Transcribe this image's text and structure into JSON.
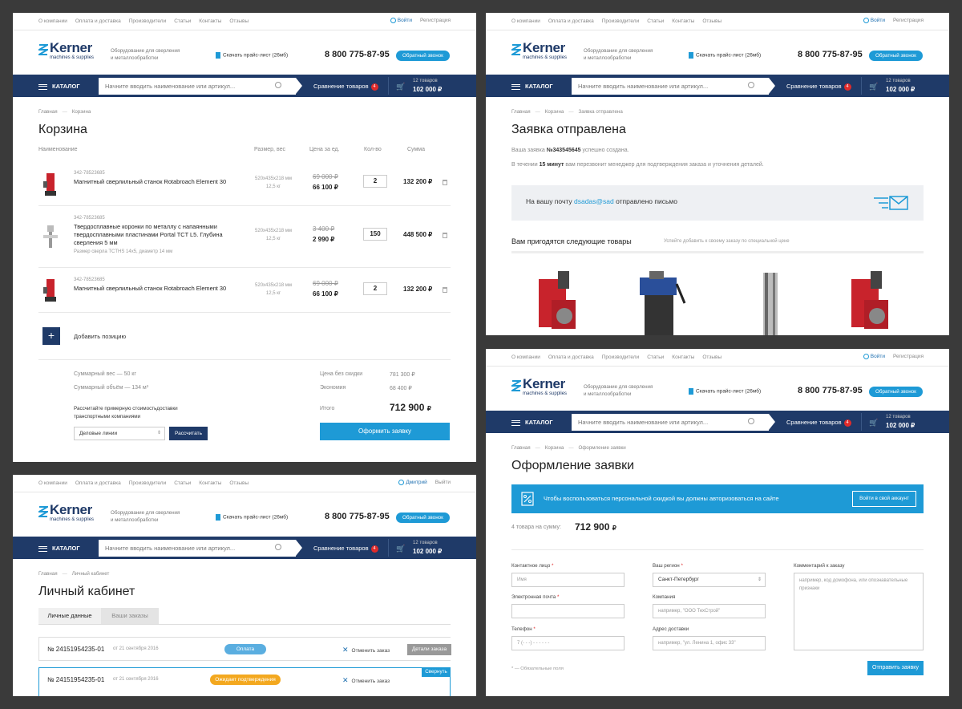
{
  "common": {
    "top_links": [
      "О компании",
      "Оплата и доставка",
      "Производители",
      "Статьи",
      "Контакты",
      "Отзывы"
    ],
    "login": "Войти",
    "register": "Регистрация",
    "brand": "Kerner",
    "brand_sub": "machines & supplies",
    "tagline": "Оборудование для сверления и металлообработки",
    "price_list": "Скачать прайс-лист (26мб)",
    "phone": "8 800 775-87-95",
    "callback": "Обратный звонок",
    "catalog": "КАТАЛОГ",
    "search_placeholder": "Начните вводить наименование или артикул...",
    "compare": "Сравнение товаров",
    "compare_count": "4",
    "cart_count": "12 товаров",
    "cart_sum": "102 000 ₽",
    "crumb_home": "Главная",
    "crumb_sep": "—"
  },
  "cart": {
    "crumb_current": "Корзина",
    "title": "Корзина",
    "col_name": "Наименование",
    "col_size": "Размер, вес",
    "col_price": "Цена за ед.",
    "col_qty": "Кол-во",
    "col_sum": "Сумма",
    "items": [
      {
        "sku": "342-78523685",
        "name": "Магнитный сверлильный станок Rotabroach Element 30",
        "note": "",
        "dims": "520x435x218 мм",
        "weight": "12,5 кг",
        "old": "69 000 ₽",
        "price": "66 100 ₽",
        "qty": "2",
        "total": "132 200 ₽"
      },
      {
        "sku": "342-78523685",
        "name": "Твердосплавные коронки по металлу с напаянными твердосплавными пластинами Portal TCT L5. Глубина сверления 5 мм",
        "note": "Размер сверла TCTHS 14x5, диаметр 14 мм",
        "dims": "520x435x218 мм",
        "weight": "12,5 кг",
        "old": "3 400 ₽",
        "price": "2 990 ₽",
        "qty": "150",
        "total": "448 500 ₽"
      },
      {
        "sku": "342-78523685",
        "name": "Магнитный сверлильный станок Rotabroach Element 30",
        "note": "",
        "dims": "520x435x218 мм",
        "weight": "12,5 кг",
        "old": "69 000 ₽",
        "price": "66 100 ₽",
        "qty": "2",
        "total": "132 200 ₽"
      }
    ],
    "add_position": "Добавить позицию",
    "weight": "Суммарный вес — 50 кг",
    "volume": "Суммарный объём — 134 м³",
    "calc_text": "Рассчитайте примерную стоимостьдоставки транспортными компаниями",
    "carrier": "Деловые линии",
    "calc_btn": "Рассчитать",
    "no_discount_label": "Цена без скидки",
    "no_discount": "781 300 ₽",
    "saving_label": "Экономия",
    "saving": "68 400 ₽",
    "total_label": "Итого",
    "total": "712 900",
    "currency": "₽",
    "checkout_btn": "Оформить заявку"
  },
  "sent": {
    "crumb_mid": "Корзина",
    "crumb_current": "Заявка отправлена",
    "title": "Заявка отправлена",
    "line1_pre": "Ваша заявка ",
    "order_no": "№343545645",
    "line1_post": " успешно создана.",
    "line2_pre": "В течении ",
    "minutes": "15 минут",
    "line2_post": " вам перезвонит менеджер для подтверждения заказа и уточнения деталей.",
    "mail_pre": "На вашу почту ",
    "email": "dsadas@sad",
    "mail_post": " отправлено письмо",
    "rec_title": "Вам пригодятся следующие товары",
    "rec_hint": "Успейте добавить к своему заказу по специальной цене"
  },
  "cabinet": {
    "user": "Дмитрий",
    "logout": "Выйти",
    "crumb_current": "Личный кабинет",
    "title": "Личный кабинет",
    "tab_personal": "Личные данные",
    "tab_orders": "Ваши заказы",
    "orders": [
      {
        "no": "№ 24151954235-01",
        "date": "от 21 сентября 2016",
        "status": "Оплата",
        "cancel": "Отменить заказ",
        "details": "Детали заказа"
      },
      {
        "no": "№ 24151954235-01",
        "date": "от 21 сентября 2016",
        "status": "Ожидает подтверждения",
        "cancel": "Отменить заказ",
        "collapse": "Свернуть"
      }
    ]
  },
  "checkout": {
    "crumb_mid": "Корзина",
    "crumb_current": "Оформление заявки",
    "title": "Оформление заявки",
    "banner": "Чтобы воспользоваться персональной скидкой вы должны авторизоваться на сайте",
    "banner_btn": "Войти в свой аккаунт",
    "sum_label": "4 товара на сумму:",
    "sum": "712 900",
    "currency": "₽",
    "contact_label": "Контактное лицо",
    "contact_ph": "Имя",
    "email_label": "Электронная почта",
    "phone_label": "Телефон",
    "phone_ph": "7 (- - -) - - - - - -",
    "region_label": "Ваш регион",
    "region": "Санкт-Петербург",
    "company_label": "Компания",
    "company_ph": "например, \"ООО ТехСтрой\"",
    "address_label": "Адрес доставки",
    "address_ph": "например, \"ул. Ленина 1, офис 33\"",
    "comment_label": "Комментарий к заказу",
    "comment_ph": "например, код домофона, или опознавательные признаки",
    "required_note": "* — Обязательные поля",
    "submit": "Отправить заявку"
  },
  "colors": {
    "navy": "#1f3a68",
    "accent": "#1e9ad6",
    "badge": "#e02b2b",
    "status_pay": "#5aaee0",
    "status_wait": "#f3a81f"
  }
}
